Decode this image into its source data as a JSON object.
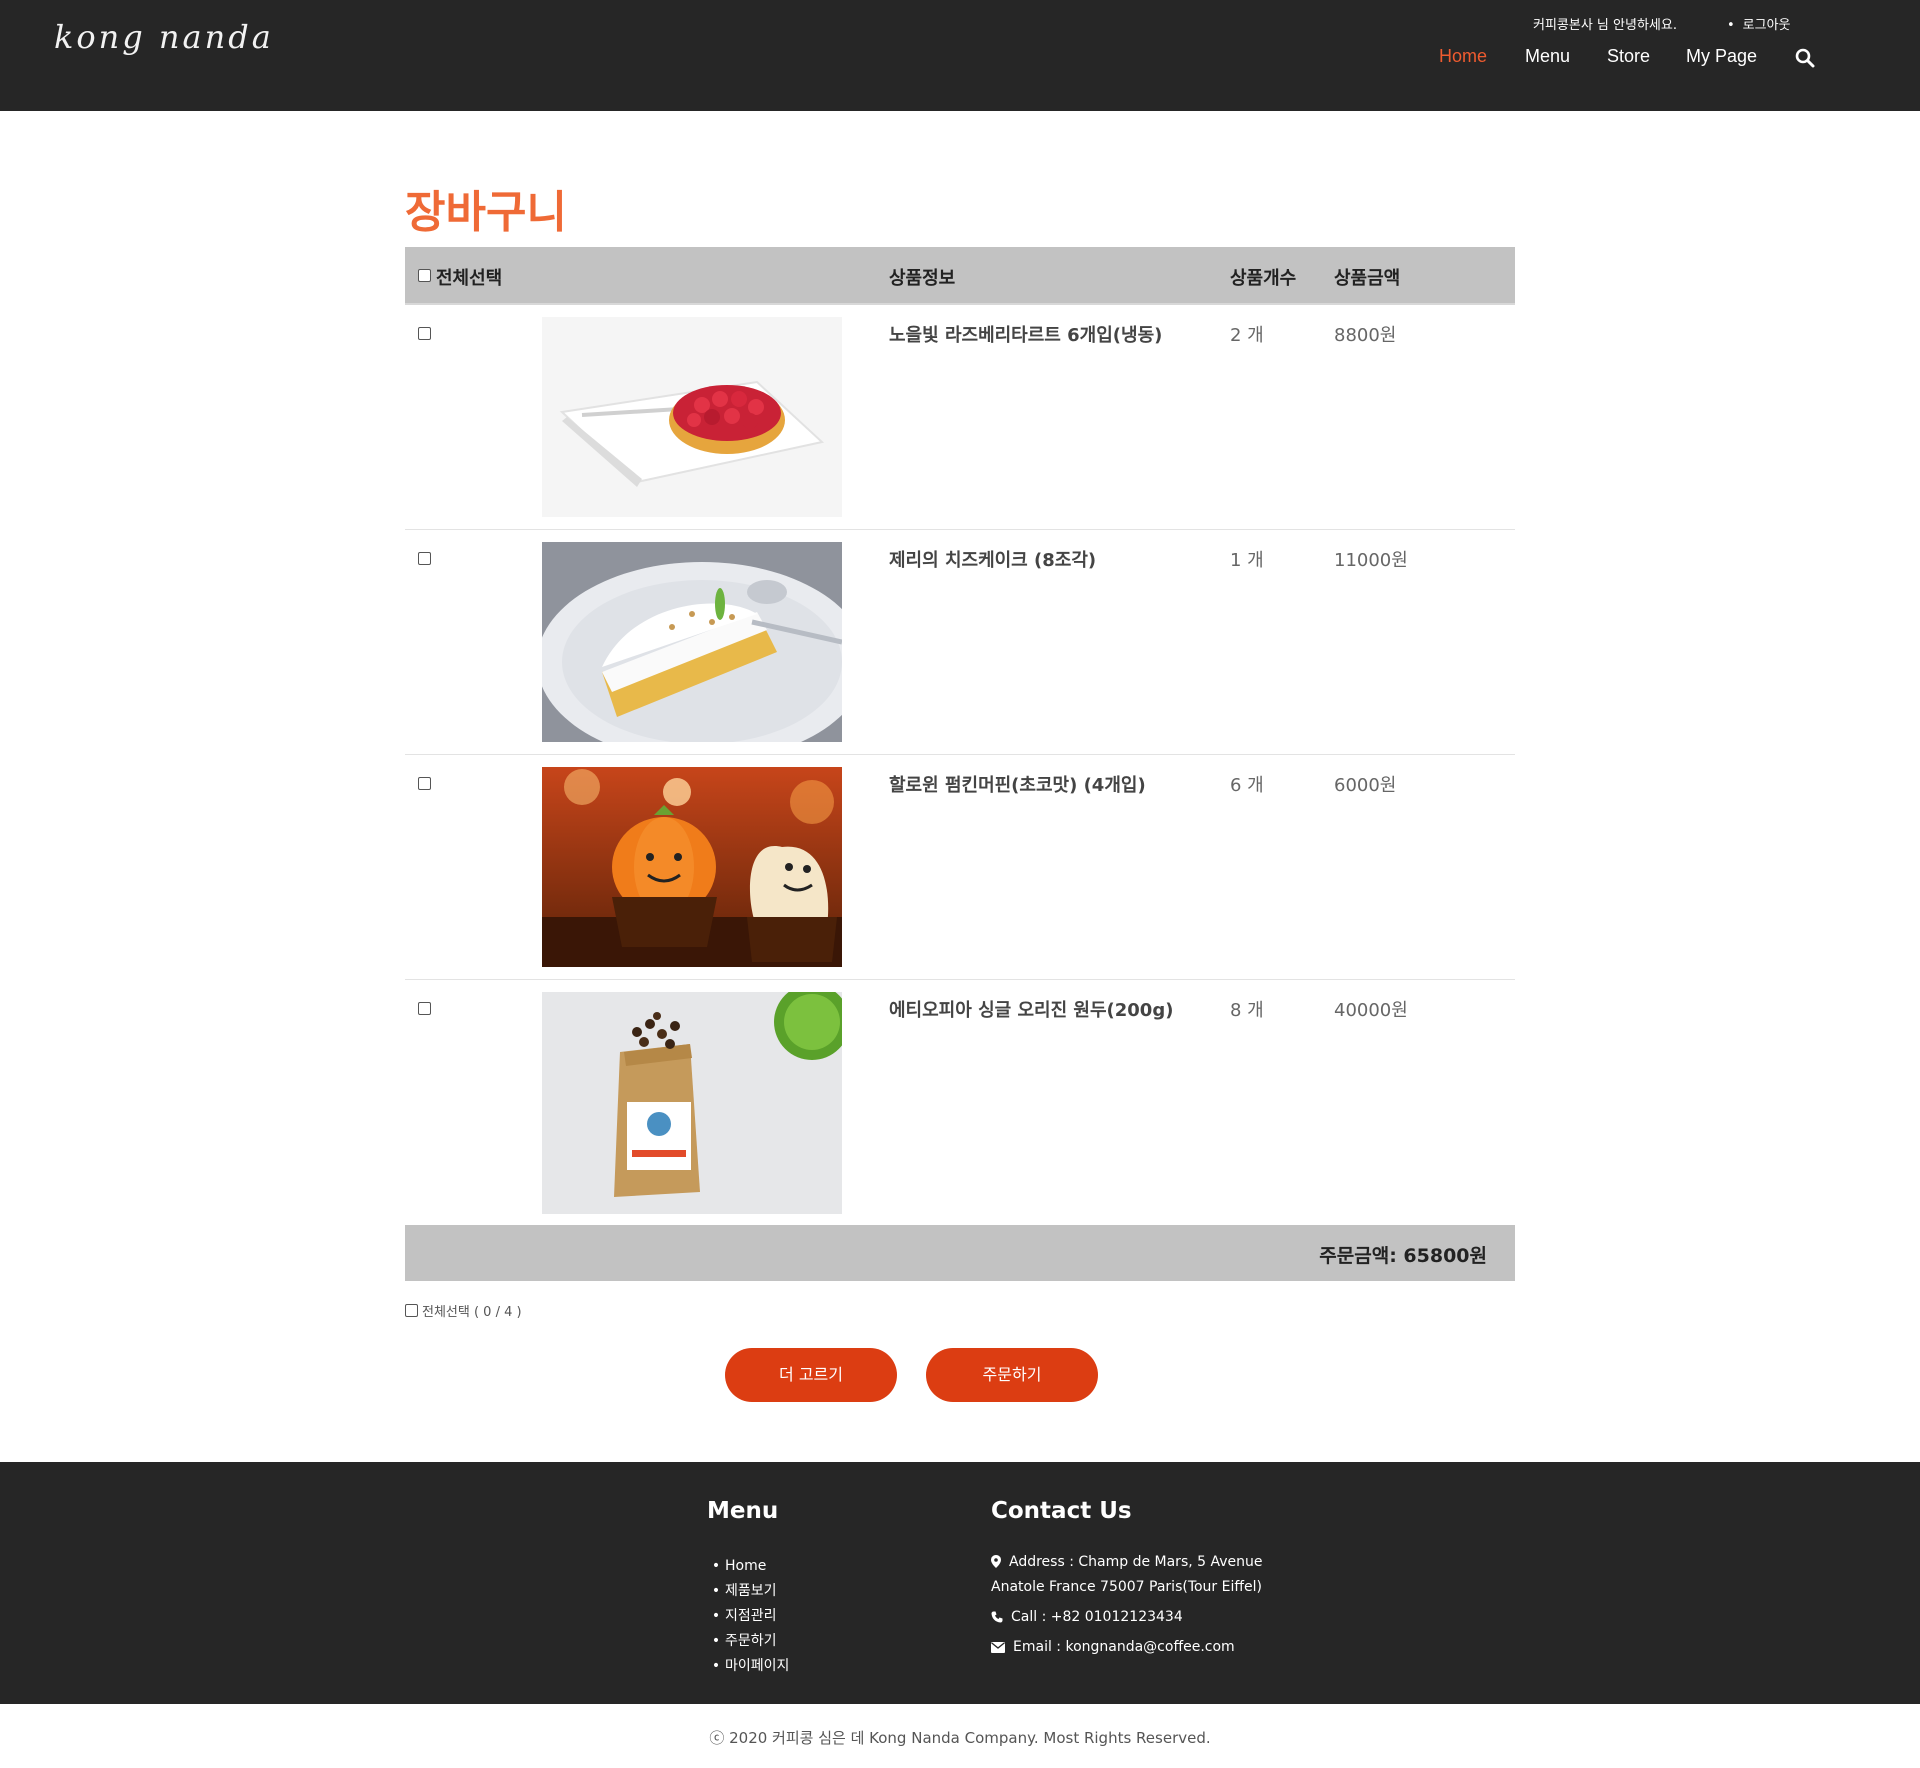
{
  "header": {
    "logo": "kong nanda",
    "welcome": "커피콩본사 님 안녕하세요.",
    "logout": "로그아웃",
    "nav": [
      "Home",
      "Menu",
      "Store",
      "My Page"
    ],
    "active_nav": "Home",
    "accent_color": "#ef5b2f"
  },
  "cart": {
    "title": "장바구니",
    "columns": {
      "select_all": "전체선택",
      "info": "상품정보",
      "qty": "상품개수",
      "price": "상품금액"
    },
    "items": [
      {
        "name": "노을빛 라즈베리타르트 6개입(냉동)",
        "qty": "2 개",
        "price": "8800원",
        "image": "raspberry-tart"
      },
      {
        "name": "제리의 치즈케이크 (8조각)",
        "qty": "1 개",
        "price": "11000원",
        "image": "cheesecake"
      },
      {
        "name": "할로윈 펌킨머핀(초코맛) (4개입)",
        "qty": "6 개",
        "price": "6000원",
        "image": "pumpkin-muffin"
      },
      {
        "name": "에티오피아 싱글 오리진 원두(200g)",
        "qty": "8 개",
        "price": "40000원",
        "image": "coffee-beans-bag"
      }
    ],
    "total": "주문금액: 65800원",
    "select_all_bottom": "전체선택 ( 0 / 4 )",
    "buttons": {
      "more": "더 고르기",
      "order": "주문하기"
    },
    "button_color": "#dc3d12"
  },
  "footer": {
    "menu_title": "Menu",
    "menu_items": [
      "Home",
      "제품보기",
      "지점관리",
      "주문하기",
      "마이페이지"
    ],
    "contact_title": "Contact Us",
    "address_line1": "Address : Champ de Mars, 5 Avenue",
    "address_line2": "Anatole France 75007 Paris(Tour Eiffel)",
    "call": "Call : +82 01012123434",
    "email": "Email : kongnanda@coffee.com"
  },
  "copyright": "ⓒ 2020 커피콩 심은 데 Kong Nanda Company. Most Rights Reserved."
}
